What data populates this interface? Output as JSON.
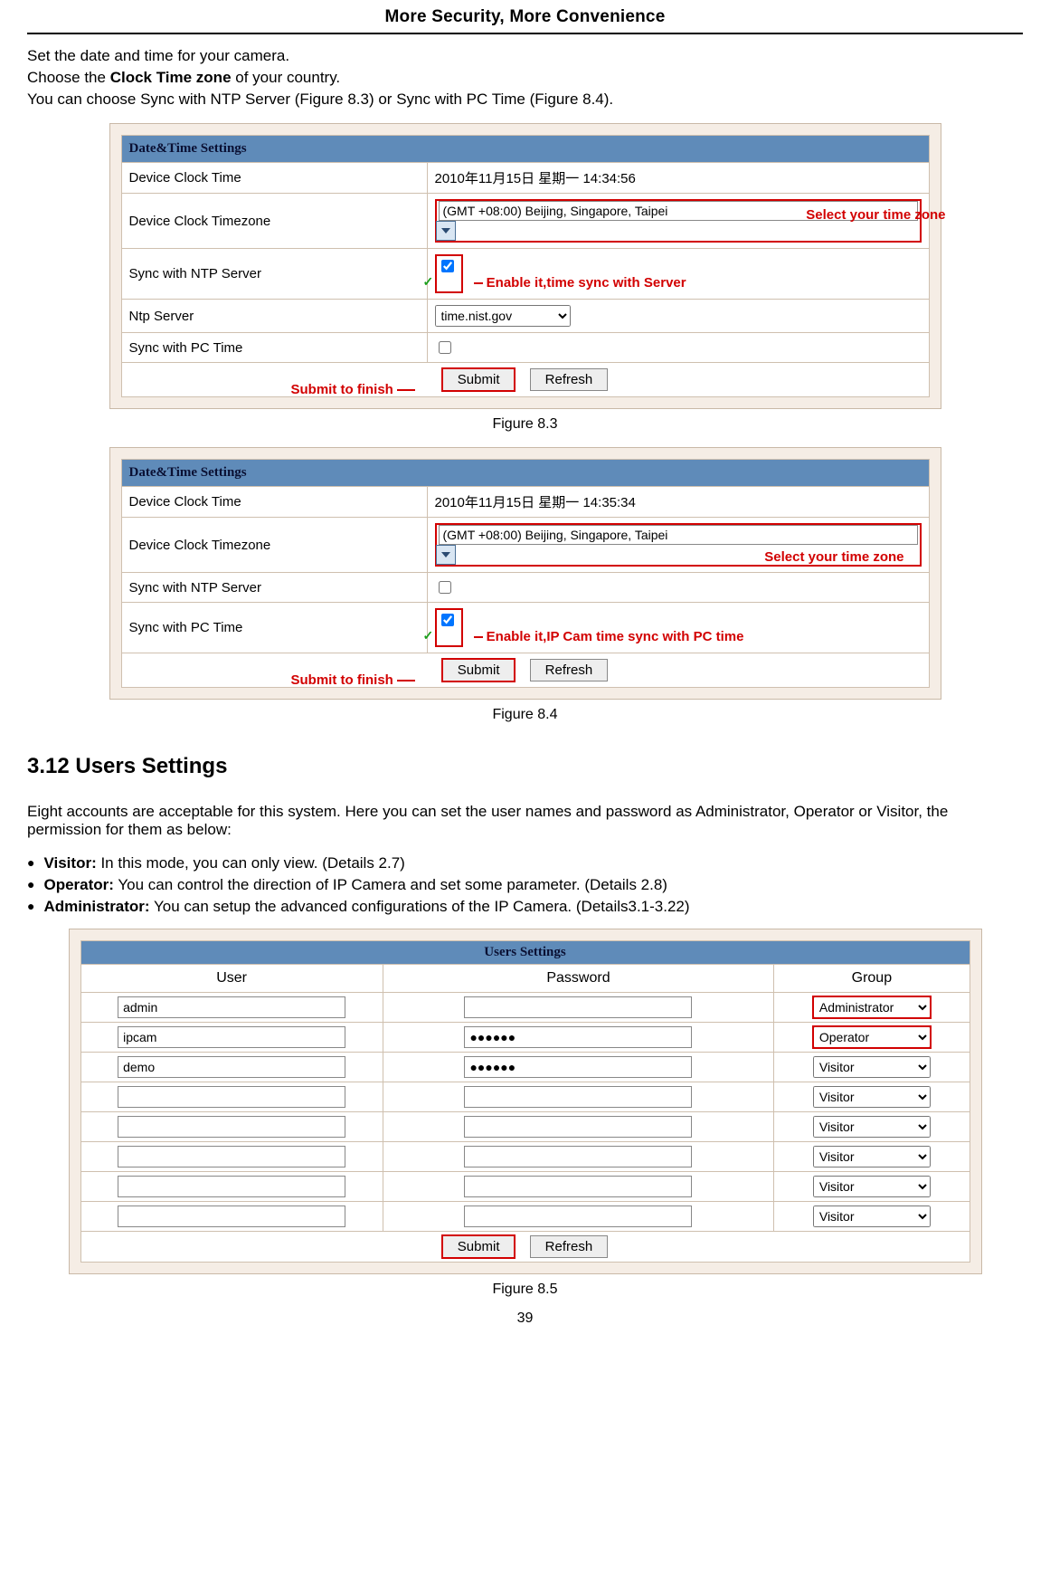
{
  "header": "More Security, More Convenience",
  "intro": {
    "l1": "Set the date and time for your camera.",
    "l2a": "Choose the ",
    "l2b": "Clock Time zone",
    "l2c": " of your country.",
    "l3": "You can choose Sync with NTP Server (Figure 8.3) or Sync with PC Time (Figure 8.4)."
  },
  "fig83": {
    "title": "Date&Time Settings",
    "rows": {
      "r1l": "Device Clock Time",
      "r1v": "2010年11月15日  星期一  14:34:56",
      "r2l": "Device Clock Timezone",
      "r2v": "(GMT +08:00) Beijing, Singapore, Taipei",
      "r3l": "Sync with NTP Server",
      "r4l": "Ntp Server",
      "r4v": "time.nist.gov",
      "r5l": "Sync with PC Time"
    },
    "annots": {
      "a1": "Enable it,time sync with Server",
      "a2": "Select your time zone",
      "a3": "Submit to finish"
    },
    "submit": "Submit",
    "refresh": "Refresh",
    "caption": "Figure 8.3"
  },
  "fig84": {
    "title": "Date&Time Settings",
    "rows": {
      "r1l": "Device Clock Time",
      "r1v": "2010年11月15日  星期一  14:35:34",
      "r2l": "Device Clock Timezone",
      "r2v": "(GMT +08:00) Beijing, Singapore, Taipei",
      "r3l": "Sync with NTP Server",
      "r4l": "Sync with PC Time"
    },
    "annots": {
      "a1": "Enable it,IP Cam time sync with PC time",
      "a2": "Select your time zone",
      "a3": "Submit to finish"
    },
    "submit": "Submit",
    "refresh": "Refresh",
    "caption": "Figure 8.4"
  },
  "section_title": "3.12 Users Settings",
  "usersIntro": "Eight accounts are acceptable for this system. Here you can set the user names and password as Administrator, Operator or Visitor, the permission for them as below:",
  "roles": {
    "visitor_b": "Visitor:",
    "visitor_t": " In this mode, you can only view. (Details 2.7)",
    "operator_b": "Operator:",
    "operator_t": " You can control the direction of IP Camera and set some parameter. (Details 2.8)",
    "admin_b": "Administrator:",
    "admin_t": " You can setup the advanced configurations of the IP Camera. (Details3.1-3.22)"
  },
  "fig85": {
    "title": "Users Settings",
    "col_user": "User",
    "col_pass": "Password",
    "col_grp": "Group",
    "rows": [
      {
        "user": "admin",
        "pass": "",
        "grp": "Administrator",
        "red": true
      },
      {
        "user": "ipcam",
        "pass": "●●●●●●",
        "grp": "Operator",
        "red": true
      },
      {
        "user": "demo",
        "pass": "●●●●●●",
        "grp": "Visitor",
        "red": false
      },
      {
        "user": "",
        "pass": "",
        "grp": "Visitor",
        "red": false
      },
      {
        "user": "",
        "pass": "",
        "grp": "Visitor",
        "red": false
      },
      {
        "user": "",
        "pass": "",
        "grp": "Visitor",
        "red": false
      },
      {
        "user": "",
        "pass": "",
        "grp": "Visitor",
        "red": false
      },
      {
        "user": "",
        "pass": "",
        "grp": "Visitor",
        "red": false
      }
    ],
    "submit": "Submit",
    "refresh": "Refresh",
    "caption": "Figure 8.5"
  },
  "page_num": "39"
}
